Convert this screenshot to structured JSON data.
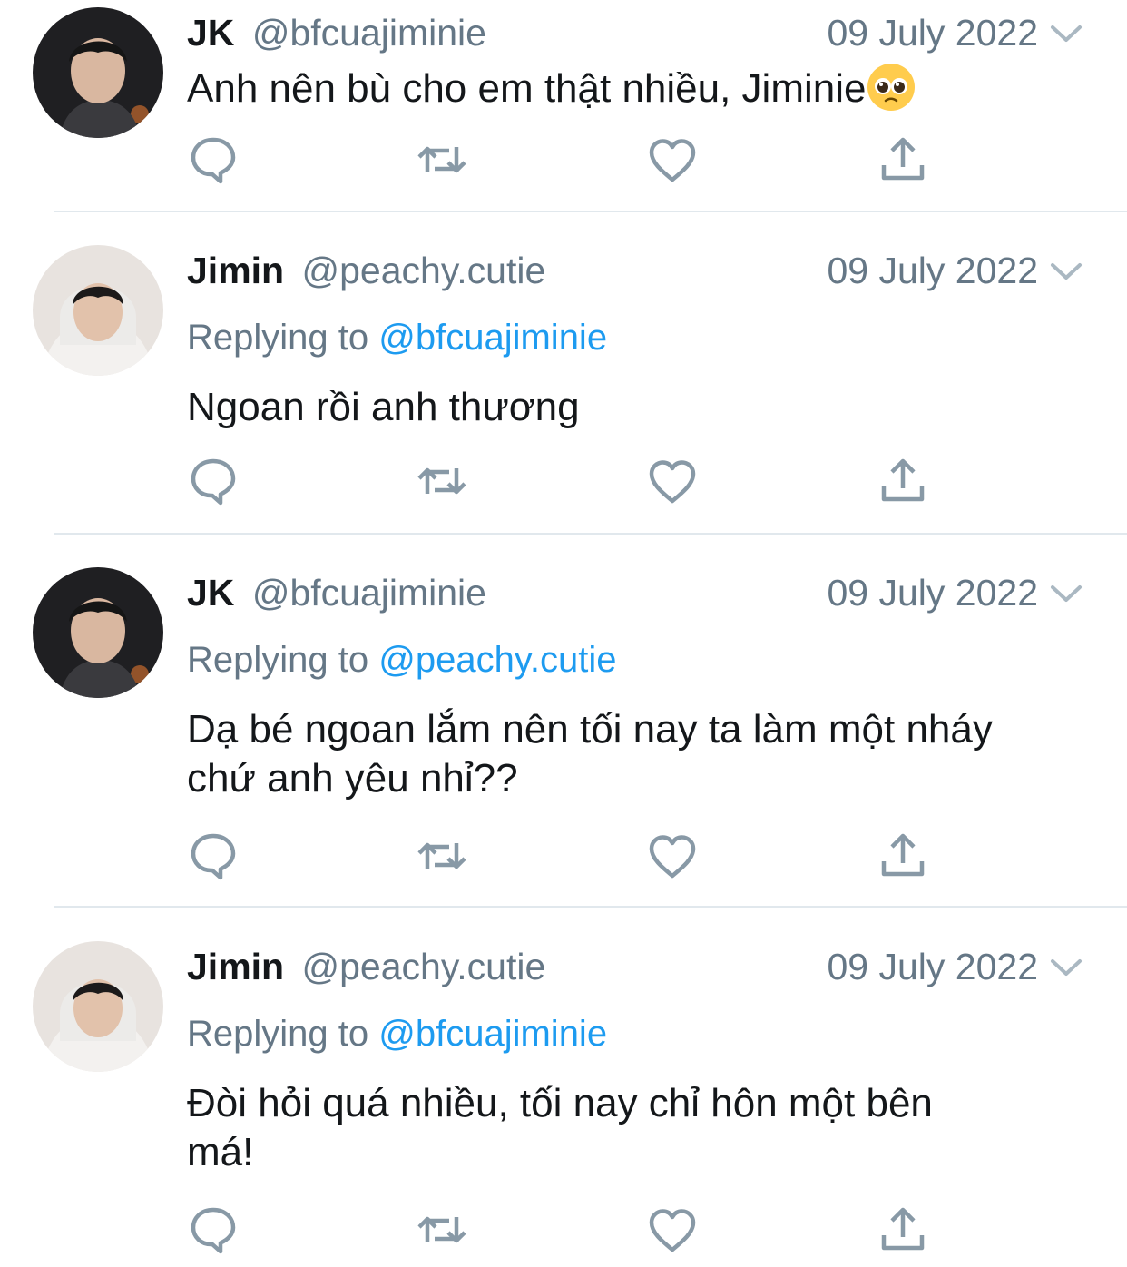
{
  "colors": {
    "text": "#14171a",
    "secondary": "#657786",
    "link": "#1d9bf0",
    "divider": "#e1e8ed"
  },
  "icons": {
    "reply": "reply-icon",
    "retweet": "retweet-icon",
    "like": "heart-icon",
    "share": "share-icon",
    "more": "chevron-down-icon"
  },
  "tweets": [
    {
      "name": "JK",
      "handle": "@bfcuajiminie",
      "date": "09 July 2022",
      "reply_prefix": "",
      "reply_to": "",
      "text_line1": "Anh nên bù cho em thật nhiều, Jiminie",
      "text_line2": "",
      "emoji": "pleading-face"
    },
    {
      "name": "Jimin",
      "handle": "@peachy.cutie",
      "date": "09 July 2022",
      "reply_prefix": "Replying to",
      "reply_to": "@bfcuajiminie",
      "text_line1": "Ngoan rồi anh thương",
      "text_line2": ""
    },
    {
      "name": "JK",
      "handle": "@bfcuajiminie",
      "date": "09 July 2022",
      "reply_prefix": "Replying to",
      "reply_to": "@peachy.cutie",
      "text_line1": "Dạ bé ngoan lắm nên tối nay ta làm một nháy",
      "text_line2": "chứ anh yêu nhỉ??"
    },
    {
      "name": "Jimin",
      "handle": "@peachy.cutie",
      "date": "09 July 2022",
      "reply_prefix": "Replying to",
      "reply_to": "@bfcuajiminie",
      "text_line1": "Đòi hỏi quá nhiều, tối nay chỉ hôn một bên",
      "text_line2": "má!"
    }
  ]
}
